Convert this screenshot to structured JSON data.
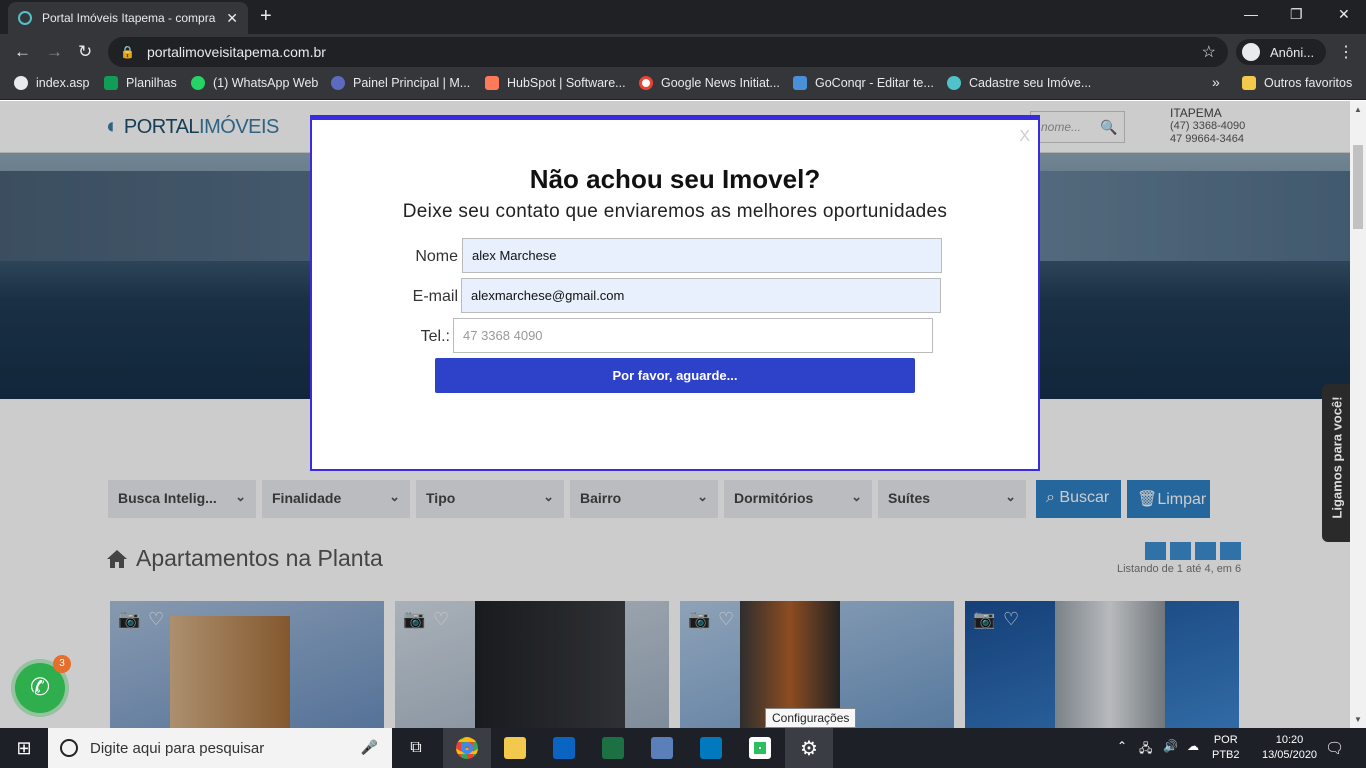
{
  "browser": {
    "tab_title": "Portal Imóveis Itapema - compra",
    "tab_close": "✕",
    "new_tab": "+",
    "url": "portalimoveisitapema.com.br",
    "profile": "Anôni...",
    "window": {
      "minimize": "—",
      "restore": "❐",
      "close": "✕"
    },
    "bookmarks": [
      {
        "label": "index.asp",
        "color": "#e8eaed"
      },
      {
        "label": "Planilhas",
        "color": "#0f9d58"
      },
      {
        "label": "(1) WhatsApp Web",
        "color": "#25d366"
      },
      {
        "label": "Painel Principal | M...",
        "color": "#5c6bc0"
      },
      {
        "label": "HubSpot | Software...",
        "color": "#ff7a59"
      },
      {
        "label": "Google News Initiat...",
        "color": "#ea4335"
      },
      {
        "label": "GoConqr - Editar te...",
        "color": "#4a90d9"
      },
      {
        "label": "Cadastre seu Imóve...",
        "color": "#4fc3c9"
      }
    ],
    "more_bookmarks": "»",
    "other_bookmarks": "Outros favoritos"
  },
  "site": {
    "logo_text": "PORTAL",
    "logo_text2": "IMÓVEIS",
    "header_search_placeholder": "nome...",
    "city": "ITAPEMA",
    "phone1": "(47) 3368-4090",
    "phone2": "47 99664-3464",
    "filters": [
      "Busca Intelig...",
      "Finalidade",
      "Tipo",
      "Bairro",
      "Dormitórios",
      "Suítes"
    ],
    "buscar": "Buscar",
    "limpar": "Limpar",
    "section_title": "Apartamentos na Planta",
    "listing_info": "Listando de 1 até 4, em 6",
    "call_tab": "Ligamos para você!",
    "whatsapp_badge": "3",
    "cards": [
      {
        "bg": "#7fa0c8",
        "tower": "#c08a52"
      },
      {
        "bg": "#b9c7d6",
        "tower": "#2f3236"
      },
      {
        "bg": "#8fb3d8",
        "tower": "#b0602a"
      },
      {
        "bg": "#2e6fb8",
        "tower": "#d4d8dc"
      }
    ]
  },
  "modal": {
    "close": "X",
    "title": "Não achou seu Imovel?",
    "subtitle": "Deixe seu contato que enviaremos as melhores oportunidades",
    "name_label": "Nome",
    "name_value": "alex Marchese",
    "email_label": "E-mail",
    "email_value": "alexmarchese@gmail.com",
    "tel_label": "Tel.:",
    "tel_placeholder": "47 3368 4090",
    "submit": "Por favor, aguarde..."
  },
  "taskbar": {
    "search_placeholder": "Digite aqui para pesquisar",
    "tooltip": "Configurações",
    "lang1": "POR",
    "lang2": "PTB2",
    "time": "10:20",
    "date": "13/05/2020"
  }
}
